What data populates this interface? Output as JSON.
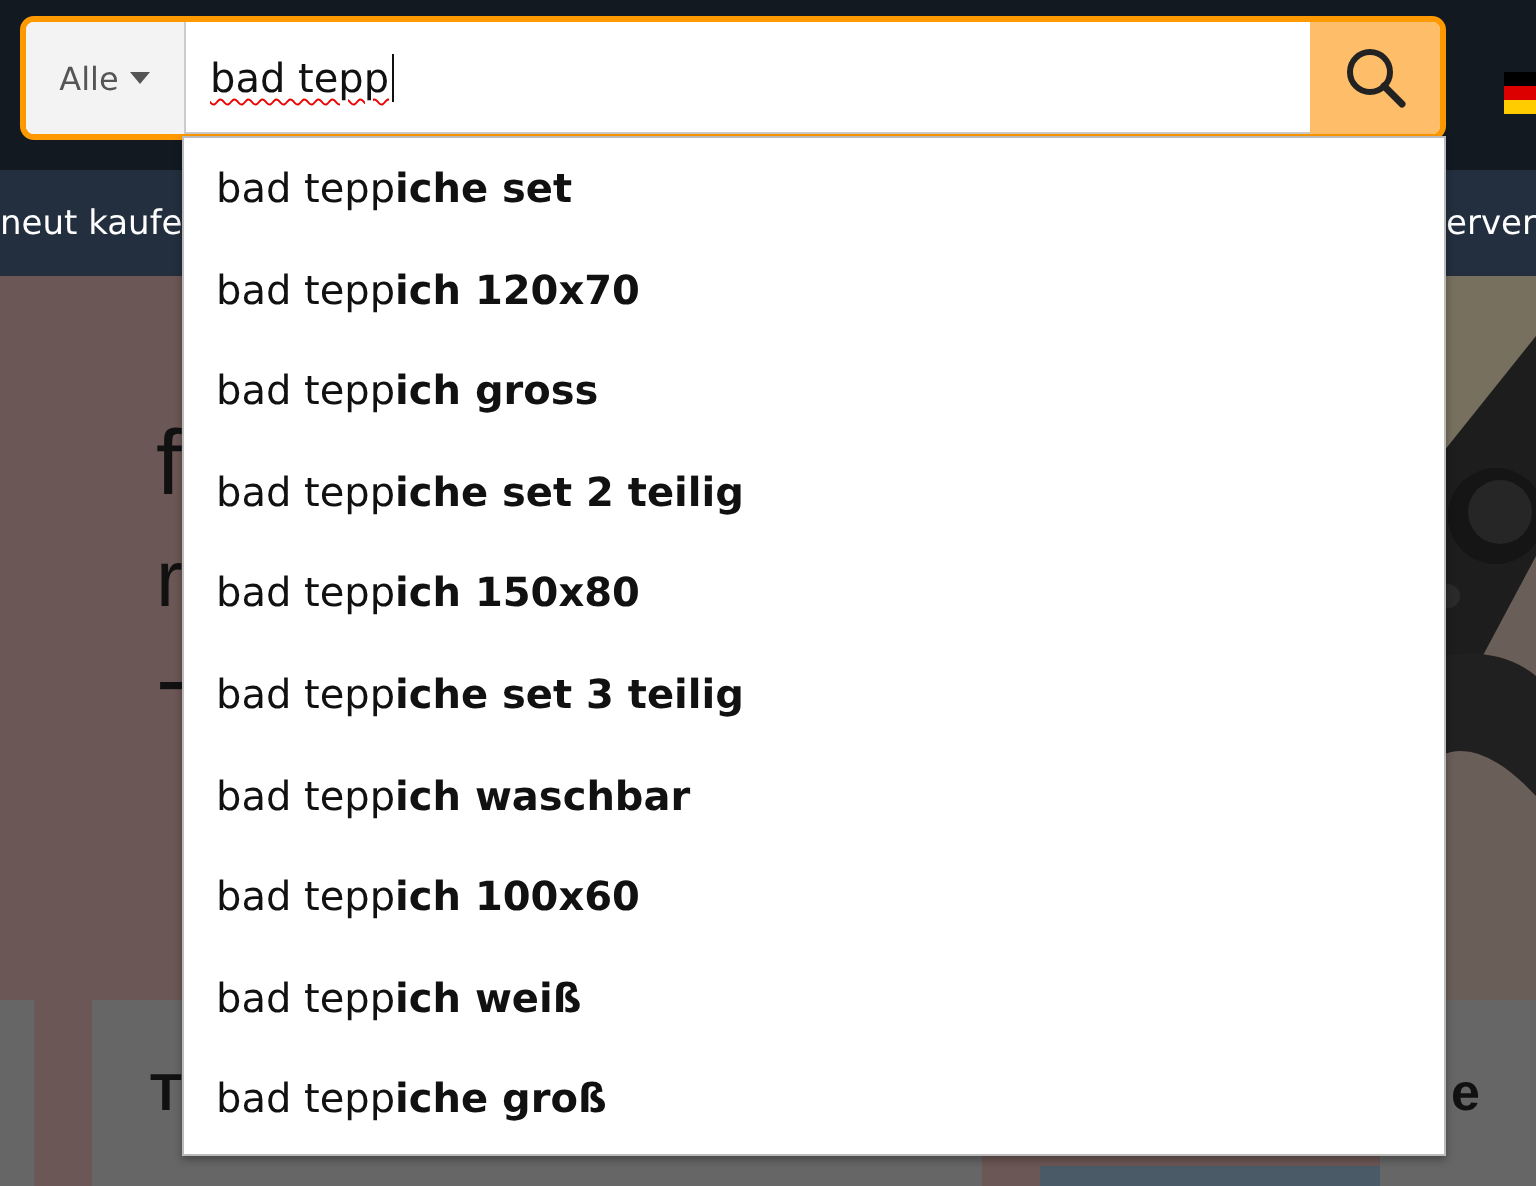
{
  "search": {
    "category": "Alle",
    "value": "bad tepp",
    "spellcheck_flag": true
  },
  "suggestions": [
    {
      "text": "bad tepp**iche set**"
    },
    {
      "text": "bad tepp**ich 120x70**"
    },
    {
      "text": "bad tepp**ich gross**"
    },
    {
      "text": "bad tepp**iche set 2 teilig**"
    },
    {
      "text": "bad tepp**ich 150x80**"
    },
    {
      "text": "bad tepp**iche set 3 teilig**"
    },
    {
      "text": "bad tepp**ich waschbar**"
    },
    {
      "text": "bad tepp**ich 100x60**"
    },
    {
      "text": "bad tepp**ich weiß**"
    },
    {
      "text": "bad tepp**iche groß**"
    }
  ],
  "nav": {
    "left_text": "neut kaufe",
    "right_text": "erver"
  },
  "hero": {
    "lines": [
      "f",
      "r",
      "-"
    ]
  },
  "cards": [
    {
      "title": "T"
    },
    {
      "title": "e"
    }
  ]
}
